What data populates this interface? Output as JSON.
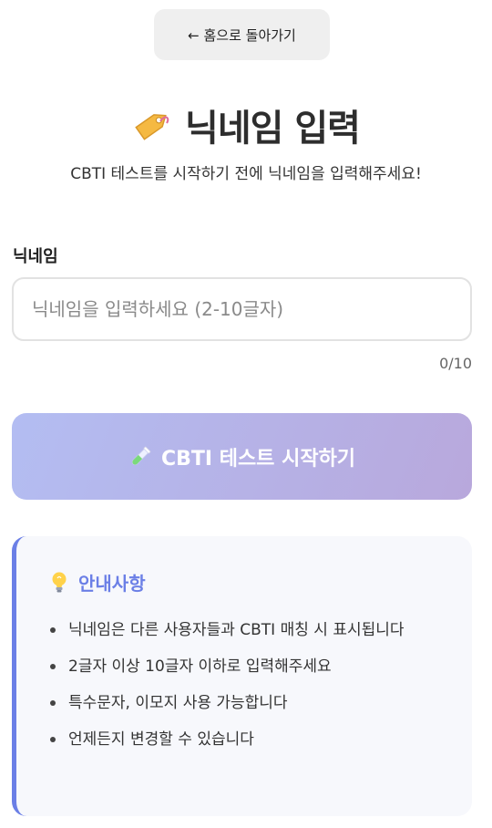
{
  "back_button": {
    "label": "← 홈으로 돌아가기"
  },
  "header": {
    "icon": "tag-icon",
    "title": "닉네임 입력",
    "subtitle": "CBTI 테스트를 시작하기 전에 닉네임을 입력해주세요!"
  },
  "form": {
    "label": "닉네임",
    "input_value": "",
    "placeholder": "닉네임을 입력하세요 (2-10글자)",
    "counter": "0/10"
  },
  "start_button": {
    "icon": "test-tube-icon",
    "label": "CBTI 테스트 시작하기"
  },
  "info": {
    "icon": "lightbulb-icon",
    "title": "안내사항",
    "items": [
      "닉네임은 다른 사용자들과 CBTI 매칭 시 표시됩니다",
      "2글자 이상 10글자 이하로 입력해주세요",
      "특수문자, 이모지 사용 가능합니다",
      "언제든지 변경할 수 있습니다"
    ]
  },
  "colors": {
    "accent": "#6b7fe6",
    "button_gradient_start": "#b3bdf2",
    "button_gradient_end": "#b8a8dc",
    "info_background": "#f7f8fc"
  }
}
